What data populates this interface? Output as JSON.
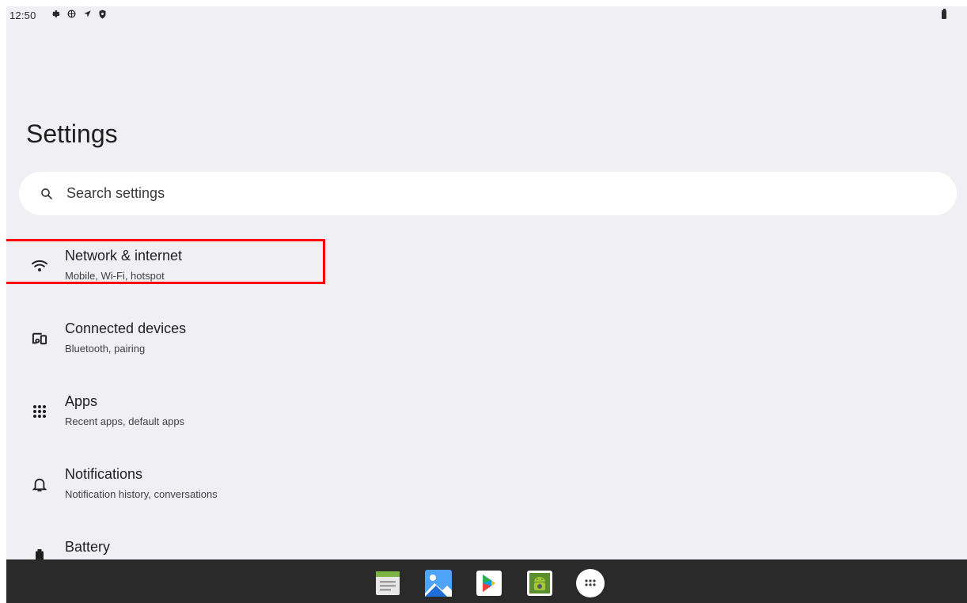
{
  "status_bar": {
    "time": "12:50",
    "icons": [
      "settings-gear-icon",
      "sync-icon",
      "location-arrow-icon",
      "shield-icon"
    ],
    "battery_icon": "battery-icon"
  },
  "page": {
    "title": "Settings"
  },
  "search": {
    "placeholder": "Search settings",
    "icon": "search-icon"
  },
  "settings_items": [
    {
      "title": "Network & internet",
      "subtitle": "Mobile, Wi-Fi, hotspot",
      "icon": "wifi-icon",
      "highlighted": true
    },
    {
      "title": "Connected devices",
      "subtitle": "Bluetooth, pairing",
      "icon": "devices-icon"
    },
    {
      "title": "Apps",
      "subtitle": "Recent apps, default apps",
      "icon": "apps-grid-icon"
    },
    {
      "title": "Notifications",
      "subtitle": "Notification history, conversations",
      "icon": "bell-icon"
    },
    {
      "title": "Battery",
      "subtitle": "",
      "icon": "battery-icon"
    }
  ],
  "taskbar": {
    "apps": [
      "notes-app-icon",
      "photos-app-icon",
      "play-store-icon",
      "android-app-icon",
      "app-drawer-icon"
    ]
  },
  "colors": {
    "background": "#f0eff4",
    "taskbar": "#2a2a2a",
    "highlight": "#ff0000"
  }
}
